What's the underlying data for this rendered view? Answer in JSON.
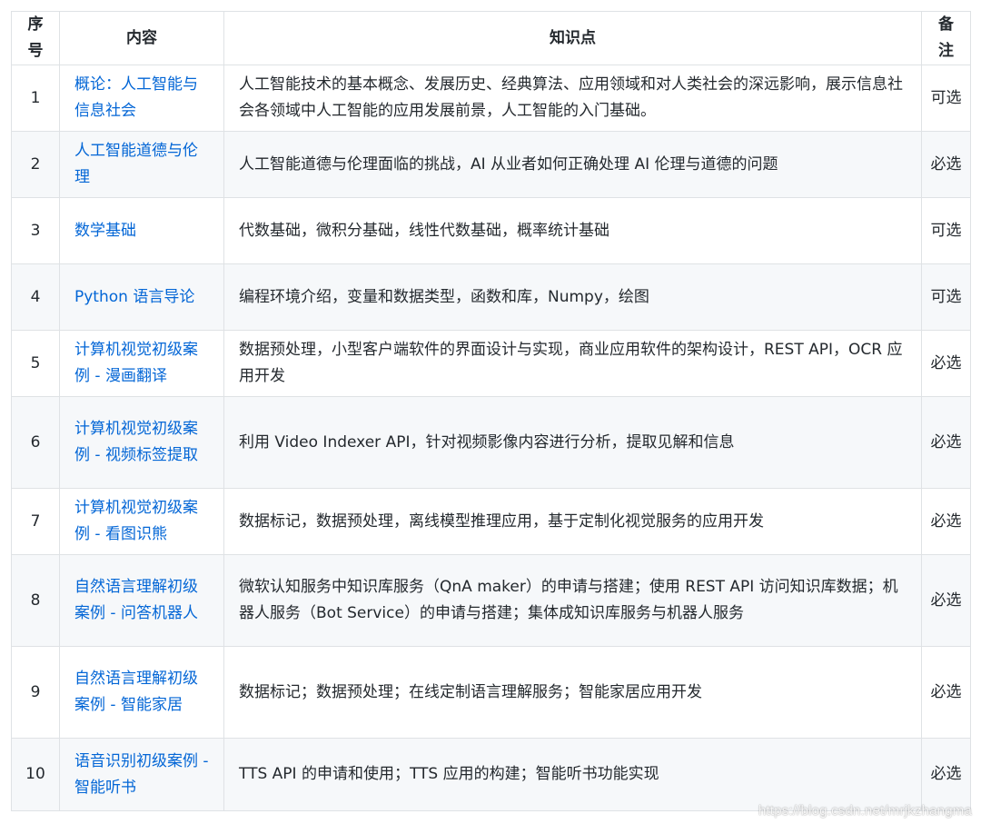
{
  "colors": {
    "link_text": "#0366d6",
    "border": "#dfe2e5",
    "stripe": "#f6f8fa",
    "text": "#24292e"
  },
  "table": {
    "headers": {
      "no": "序\n号",
      "content": "内容",
      "points": "知识点",
      "note": "备\n注"
    },
    "rows": [
      {
        "no": "1",
        "content": "概论：人工智能与信息社会",
        "points": "人工智能技术的基本概念、发展历史、经典算法、应用领域和对人类社会的深远影响，展示信息社会各领域中人工智能的应用发展前景，人工智能的入门基础。",
        "note": "可选"
      },
      {
        "no": "2",
        "content": "人工智能道德与伦理",
        "points": "人工智能道德与伦理面临的挑战，AI 从业者如何正确处理 AI 伦理与道德的问题",
        "note": "必选"
      },
      {
        "no": "3",
        "content": "数学基础",
        "points": "代数基础，微积分基础，线性代数基础，概率统计基础",
        "note": "可选"
      },
      {
        "no": "4",
        "content": "Python 语言导论",
        "points": "编程环境介绍，变量和数据类型，函数和库，Numpy，绘图",
        "note": "可选"
      },
      {
        "no": "5",
        "content": "计算机视觉初级案例 - 漫画翻译",
        "points": "数据预处理，小型客户端软件的界面设计与实现，商业应用软件的架构设计，REST API，OCR 应用开发",
        "note": "必选"
      },
      {
        "no": "6",
        "content": "计算机视觉初级案例 - 视频标签提取",
        "points": "利用 Video Indexer API，针对视频影像内容进行分析，提取见解和信息",
        "note": "必选"
      },
      {
        "no": "7",
        "content": "计算机视觉初级案例 - 看图识熊",
        "points": "数据标记，数据预处理，离线模型推理应用，基于定制化视觉服务的应用开发",
        "note": "必选"
      },
      {
        "no": "8",
        "content": "自然语言理解初级案例 - 问答机器人",
        "points": "微软认知服务中知识库服务（QnA maker）的申请与搭建；使用 REST API 访问知识库数据；机器人服务（Bot Service）的申请与搭建；集体成知识库服务与机器人服务",
        "note": "必选"
      },
      {
        "no": "9",
        "content": "自然语言理解初级案例 - 智能家居",
        "points": "数据标记；数据预处理；在线定制语言理解服务；智能家居应用开发",
        "note": "必选"
      },
      {
        "no": "10",
        "content": "语音识别初级案例 - 智能听书",
        "points": "TTS API 的申请和使用；TTS 应用的构建；智能听书功能实现",
        "note": "必选"
      }
    ]
  },
  "watermark": "https://blog.csdn.net/mrjkzhangma"
}
